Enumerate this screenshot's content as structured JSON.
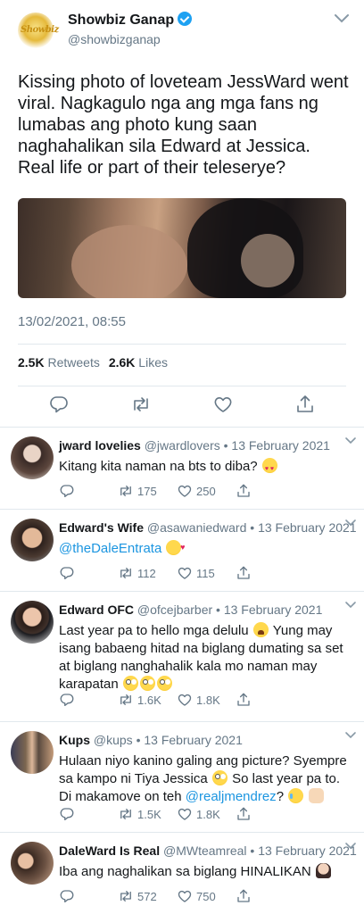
{
  "tweet": {
    "author_name": "Showbiz Ganap",
    "handle": "@showbizganap",
    "logo_text": "Showbiz",
    "text": "Kissing photo of loveteam JessWard went viral. Nagkagulo nga ang mga fans ng lumabas ang photo kung saan naghahalikan sila Edward at Jessica. Real life or part of their teleserye?",
    "timestamp": "13/02/2021, 08:55",
    "retweets_count": "2.5K",
    "retweets_label": "Retweets",
    "likes_count": "2.6K",
    "likes_label": "Likes"
  },
  "replies": [
    {
      "name": "jward lovelies",
      "meta": "@jwardlovers • 13 February 2021",
      "text_parts": [
        "Kitang kita naman na bts to diba?"
      ],
      "retweets": "175",
      "likes": "250"
    },
    {
      "name": "Edward's Wife",
      "meta": "@asawaniedward • 13 February 2021",
      "mention": "@theDaleEntrata",
      "retweets": "112",
      "likes": "115"
    },
    {
      "name": "Edward OFC",
      "meta": "@ofcejbarber • 13 February 2021",
      "text_parts": [
        "Last year pa to hello mga delulu",
        "Yung may isang babaeng hitad na biglang dumating sa set at biglang nanghahalik kala mo naman may karapatan"
      ],
      "retweets": "1.6K",
      "likes": "1.8K"
    },
    {
      "name": "Kups",
      "meta": "@kups • 13 February 2021",
      "text_parts": [
        "Hulaan niyo kanino galing ang picture? Syempre sa kampo ni Tiya Jessica",
        "So last year pa to. Di makamove on teh"
      ],
      "mention": "@realjmendrez",
      "tail": "?",
      "retweets": "1.5K",
      "likes": "1.8K"
    },
    {
      "name": "DaleWard Is Real",
      "meta": "@MWteamreal • 13 February 2021",
      "text_parts": [
        "Iba ang naghalikan sa biglang HINALIKAN"
      ],
      "retweets": "572",
      "likes": "750"
    }
  ],
  "icons": [
    "reply-icon",
    "retweet-icon",
    "like-icon",
    "share-icon",
    "chevron-down-icon",
    "verified-badge-icon"
  ],
  "colors": {
    "link": "#1b95e0",
    "verified": "#1da1f2",
    "secondary_text": "#657786",
    "divider": "#e1e8ed"
  }
}
